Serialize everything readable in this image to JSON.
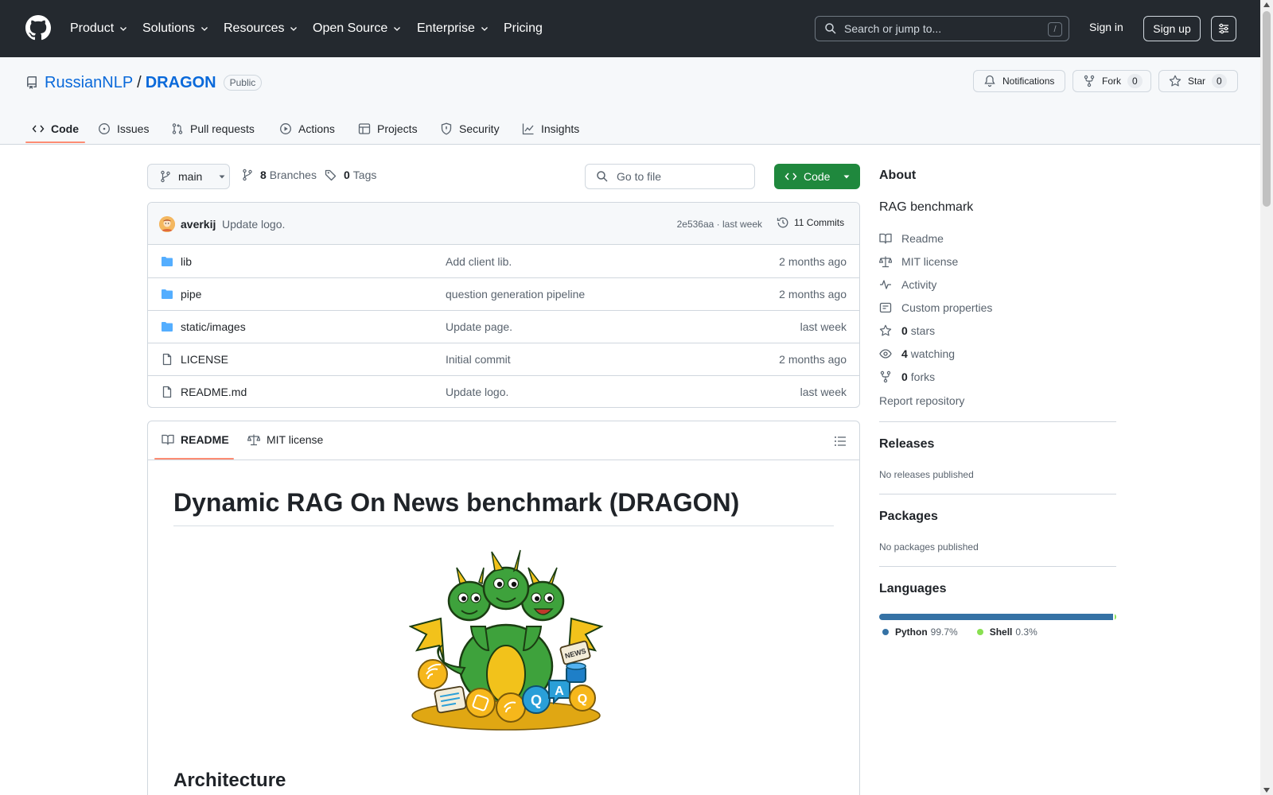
{
  "colors": {
    "header_bg": "#24292f",
    "accent": "#0969da",
    "code_button": "#1f883d",
    "tab_underline": "#fd8c73",
    "python": "#3572a5",
    "shell": "#89e051"
  },
  "header": {
    "nav": [
      "Product",
      "Solutions",
      "Resources",
      "Open Source",
      "Enterprise",
      "Pricing"
    ],
    "search_placeholder": "Search or jump to...",
    "search_key": "/",
    "signin": "Sign in",
    "signup": "Sign up"
  },
  "repo": {
    "owner": "RussianNLP",
    "separator": "/",
    "name": "DRAGON",
    "visibility": "Public",
    "notifications_label": "Notifications",
    "fork_label": "Fork",
    "fork_count": "0",
    "star_label": "Star",
    "star_count": "0"
  },
  "tabs": [
    "Code",
    "Issues",
    "Pull requests",
    "Actions",
    "Projects",
    "Security",
    "Insights"
  ],
  "toolbar": {
    "branch": "main",
    "branches_count": "8",
    "branches_label": "Branches",
    "tags_count": "0",
    "tags_label": "Tags",
    "goto_placeholder": "Go to file",
    "code_label": "Code"
  },
  "commit": {
    "author": "averkij",
    "message": "Update logo.",
    "sha_time": "2e536aa · last week",
    "commits_label": "11 Commits"
  },
  "files": [
    {
      "type": "folder",
      "name": "lib",
      "message": "Add client lib.",
      "age": "2 months ago"
    },
    {
      "type": "folder",
      "name": "pipe",
      "message": "question generation pipeline",
      "age": "2 months ago"
    },
    {
      "type": "folder",
      "name": "static/images",
      "message": "Update page.",
      "age": "last week"
    },
    {
      "type": "file",
      "name": "LICENSE",
      "message": "Initial commit",
      "age": "2 months ago"
    },
    {
      "type": "file",
      "name": "README.md",
      "message": "Update logo.",
      "age": "last week"
    }
  ],
  "readme": {
    "tab_readme": "README",
    "tab_license": "MIT license",
    "h1": "Dynamic RAG On News benchmark (DRAGON)",
    "h2": "Architecture",
    "logo_icons": [
      "dragon-logo-icon"
    ],
    "logo_text": [
      "NEWS",
      "Q",
      "A",
      "Q"
    ]
  },
  "about": {
    "title": "About",
    "description": "RAG benchmark",
    "readme": "Readme",
    "license": "MIT license",
    "activity": "Activity",
    "custom_properties": "Custom properties",
    "stars_count": "0",
    "stars_label": "stars",
    "watching_count": "4",
    "watching_label": "watching",
    "forks_count": "0",
    "forks_label": "forks",
    "report": "Report repository"
  },
  "releases": {
    "title": "Releases",
    "note": "No releases published"
  },
  "packages": {
    "title": "Packages",
    "note": "No packages published"
  },
  "languages": {
    "title": "Languages",
    "items": [
      {
        "name": "Python",
        "percent": "99.7%",
        "share": 99.7
      },
      {
        "name": "Shell",
        "percent": "0.3%",
        "share": 0.3
      }
    ]
  }
}
